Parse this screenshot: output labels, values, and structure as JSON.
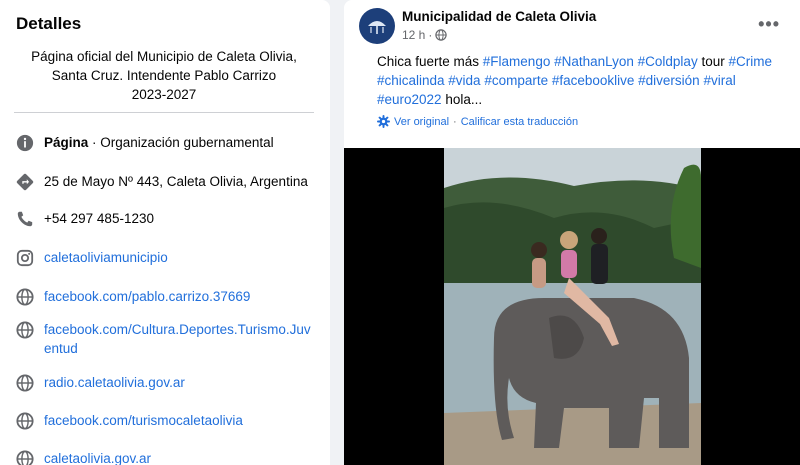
{
  "details": {
    "title": "Detalles",
    "bio_lines": [
      "Página oficial del Municipio de Caleta Olivia,",
      "Santa Cruz. Intendente Pablo Carrizo",
      "2023-2027"
    ],
    "items": [
      {
        "icon": "info-icon",
        "bold": "Página",
        "text": " · Organización gubernamental"
      },
      {
        "icon": "map-pin-icon",
        "text": "25 de Mayo Nº 443, Caleta Olivia, Argentina"
      },
      {
        "icon": "phone-icon",
        "text": "+54 297 485-1230"
      },
      {
        "icon": "instagram-icon",
        "text": "caletaoliviamunicipio"
      },
      {
        "icon": "globe-icon",
        "text": "facebook.com/pablo.carrizo.37669"
      },
      {
        "icon": "globe-icon",
        "text": "facebook.com/Cultura.Deportes.Turismo.Juv"
      },
      {
        "icon": "globe-icon",
        "text": "entud"
      },
      {
        "icon": "globe-icon",
        "text": "radio.caletaolivia.gov.ar"
      },
      {
        "icon": "globe-icon",
        "text": "facebook.com/turismocaletaolivia"
      },
      {
        "icon": "globe-icon",
        "text": "caletaolivia.gov.ar"
      }
    ]
  },
  "post": {
    "page_name": "Municipalidad de Caleta Olivia",
    "time": "12 h",
    "text_plain1": "Chica fuerte más ",
    "tags1": "#Flamengo #NathanLyon #Coldplay",
    "text_plain2": " tour ",
    "tag_crime": "#Crime",
    "tags2": "#chicalinda #vida #comparte #facebooklive #diversión #viral",
    "tag_euro": "#euro2022",
    "text_end": " hola...",
    "translate_original": "Ver original",
    "translate_rate": "Calificar esta traducción"
  },
  "colors": {
    "link": "#216fdb",
    "muted": "#65676b",
    "icon": "#65676b"
  }
}
